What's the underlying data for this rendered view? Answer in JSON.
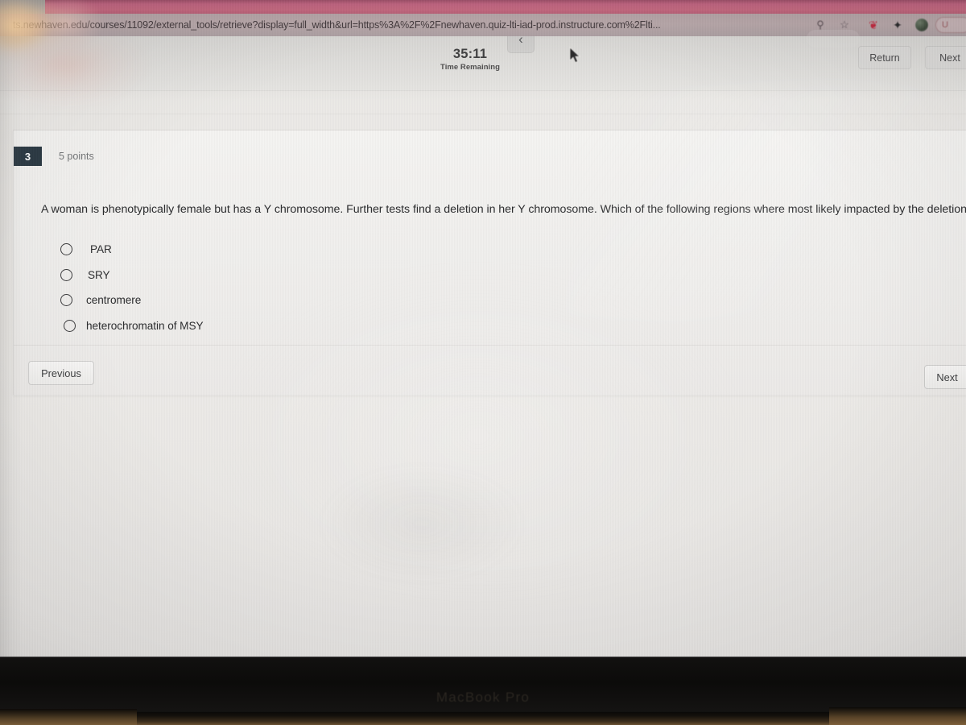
{
  "browser": {
    "url": "ts.newhaven.edu/courses/11092/external_tools/retrieve?display=full_width&url=https%3A%2F%2Fnewhaven.quiz-lti-iad-prod.instructure.com%2Flti...",
    "toolbar_icons": [
      {
        "name": "reader-icon",
        "glyph": "⚲"
      },
      {
        "name": "bookmark-star-icon",
        "glyph": "☆"
      },
      {
        "name": "extension-red-icon",
        "glyph": "❦"
      },
      {
        "name": "extension-dark-icon",
        "glyph": "✦"
      },
      {
        "name": "extension-globe-icon",
        "glyph": ""
      }
    ],
    "account_pill_label": "U",
    "tab_strip_color": "#c2687f"
  },
  "quiz_header": {
    "timer_value": "35:11",
    "timer_label": "Time Remaining",
    "collapse_icon": "‹",
    "return_label": "Return",
    "next_label": "Next"
  },
  "question": {
    "number": "3",
    "points": "5 points",
    "text": "A woman is phenotypically female but has a Y chromosome.  Further tests find a deletion in her Y chromosome.  Which of the following regions where most likely impacted by the deletion?",
    "options": [
      {
        "label": "PAR",
        "selected": false
      },
      {
        "label": "SRY",
        "selected": false
      },
      {
        "label": "centromere",
        "selected": false
      },
      {
        "label": "heterochromatin of MSY",
        "selected": false
      }
    ]
  },
  "footer_nav": {
    "previous_label": "Previous",
    "next_label": "Next"
  },
  "device": {
    "brand_label": "MacBook Pro"
  },
  "colors": {
    "question_badge": "#2d3b45",
    "page_background": "#ecebe8",
    "card_background": "#f3f2f0",
    "text_primary": "#2b2c2e",
    "text_muted": "#76787a"
  }
}
